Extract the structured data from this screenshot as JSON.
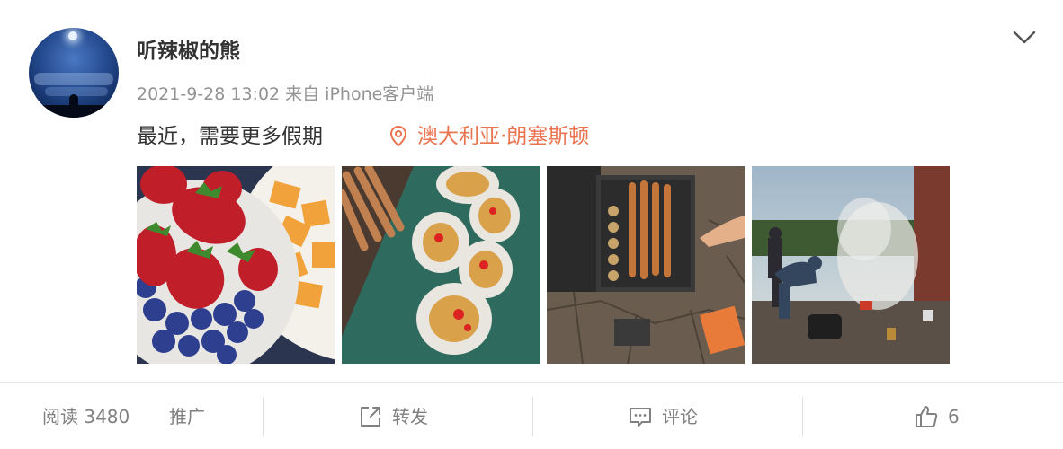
{
  "user": {
    "name": "听辣椒的熊"
  },
  "post": {
    "timestamp": "2021-9-28 13:02",
    "source": "来自 iPhone客户端",
    "text": "最近，需要更多假期",
    "location": "澳大利亚·朗塞斯顿"
  },
  "footer": {
    "read": "阅读 3480",
    "promote": "推广",
    "repost": "转发",
    "comment": "评论",
    "likes": "6"
  },
  "colors": {
    "accent": "#eb7350",
    "meta": "#939393",
    "text": "#333333"
  },
  "icons": {
    "menu": "chevron-down-icon",
    "location": "location-pin-icon",
    "repost": "share-icon",
    "comment": "comment-icon",
    "like": "thumbs-up-icon"
  }
}
